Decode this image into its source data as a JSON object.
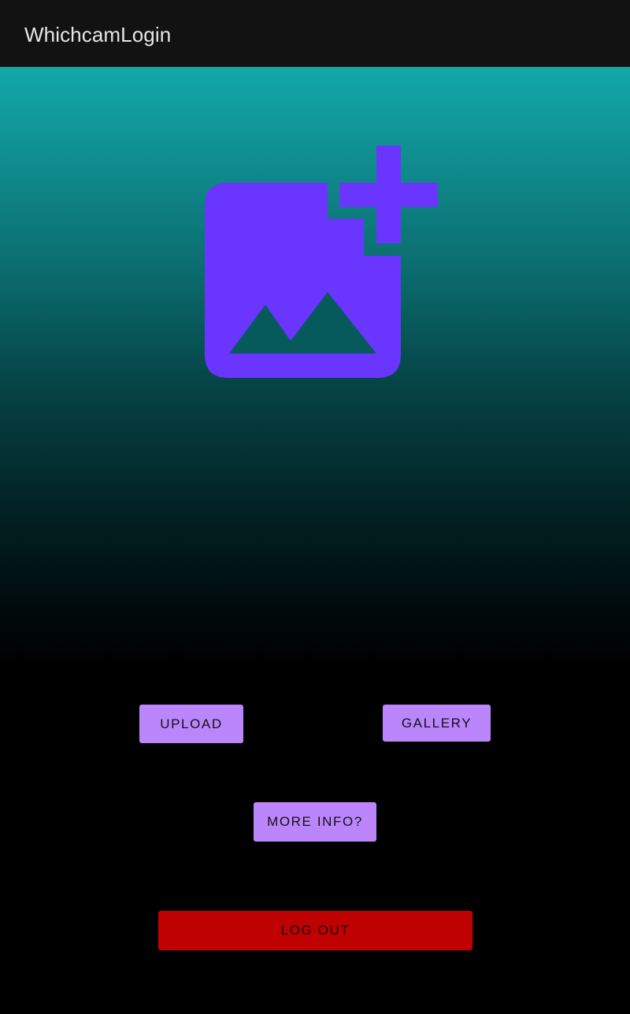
{
  "app_bar": {
    "title": "WhichcamLogin"
  },
  "main": {
    "image_icon": "add-photo-alternate-icon",
    "buttons": {
      "upload": "UPLOAD",
      "gallery": "GALLERY",
      "more_info": "MORE INFO?",
      "logout": "LOG OUT"
    }
  },
  "colors": {
    "toolbar": "#121212",
    "gradient_top": "#13a8a8",
    "gradient_bottom": "#000000",
    "icon": "#6a35ff",
    "button_primary": "#bb86fc",
    "button_logout": "#bf0101"
  }
}
